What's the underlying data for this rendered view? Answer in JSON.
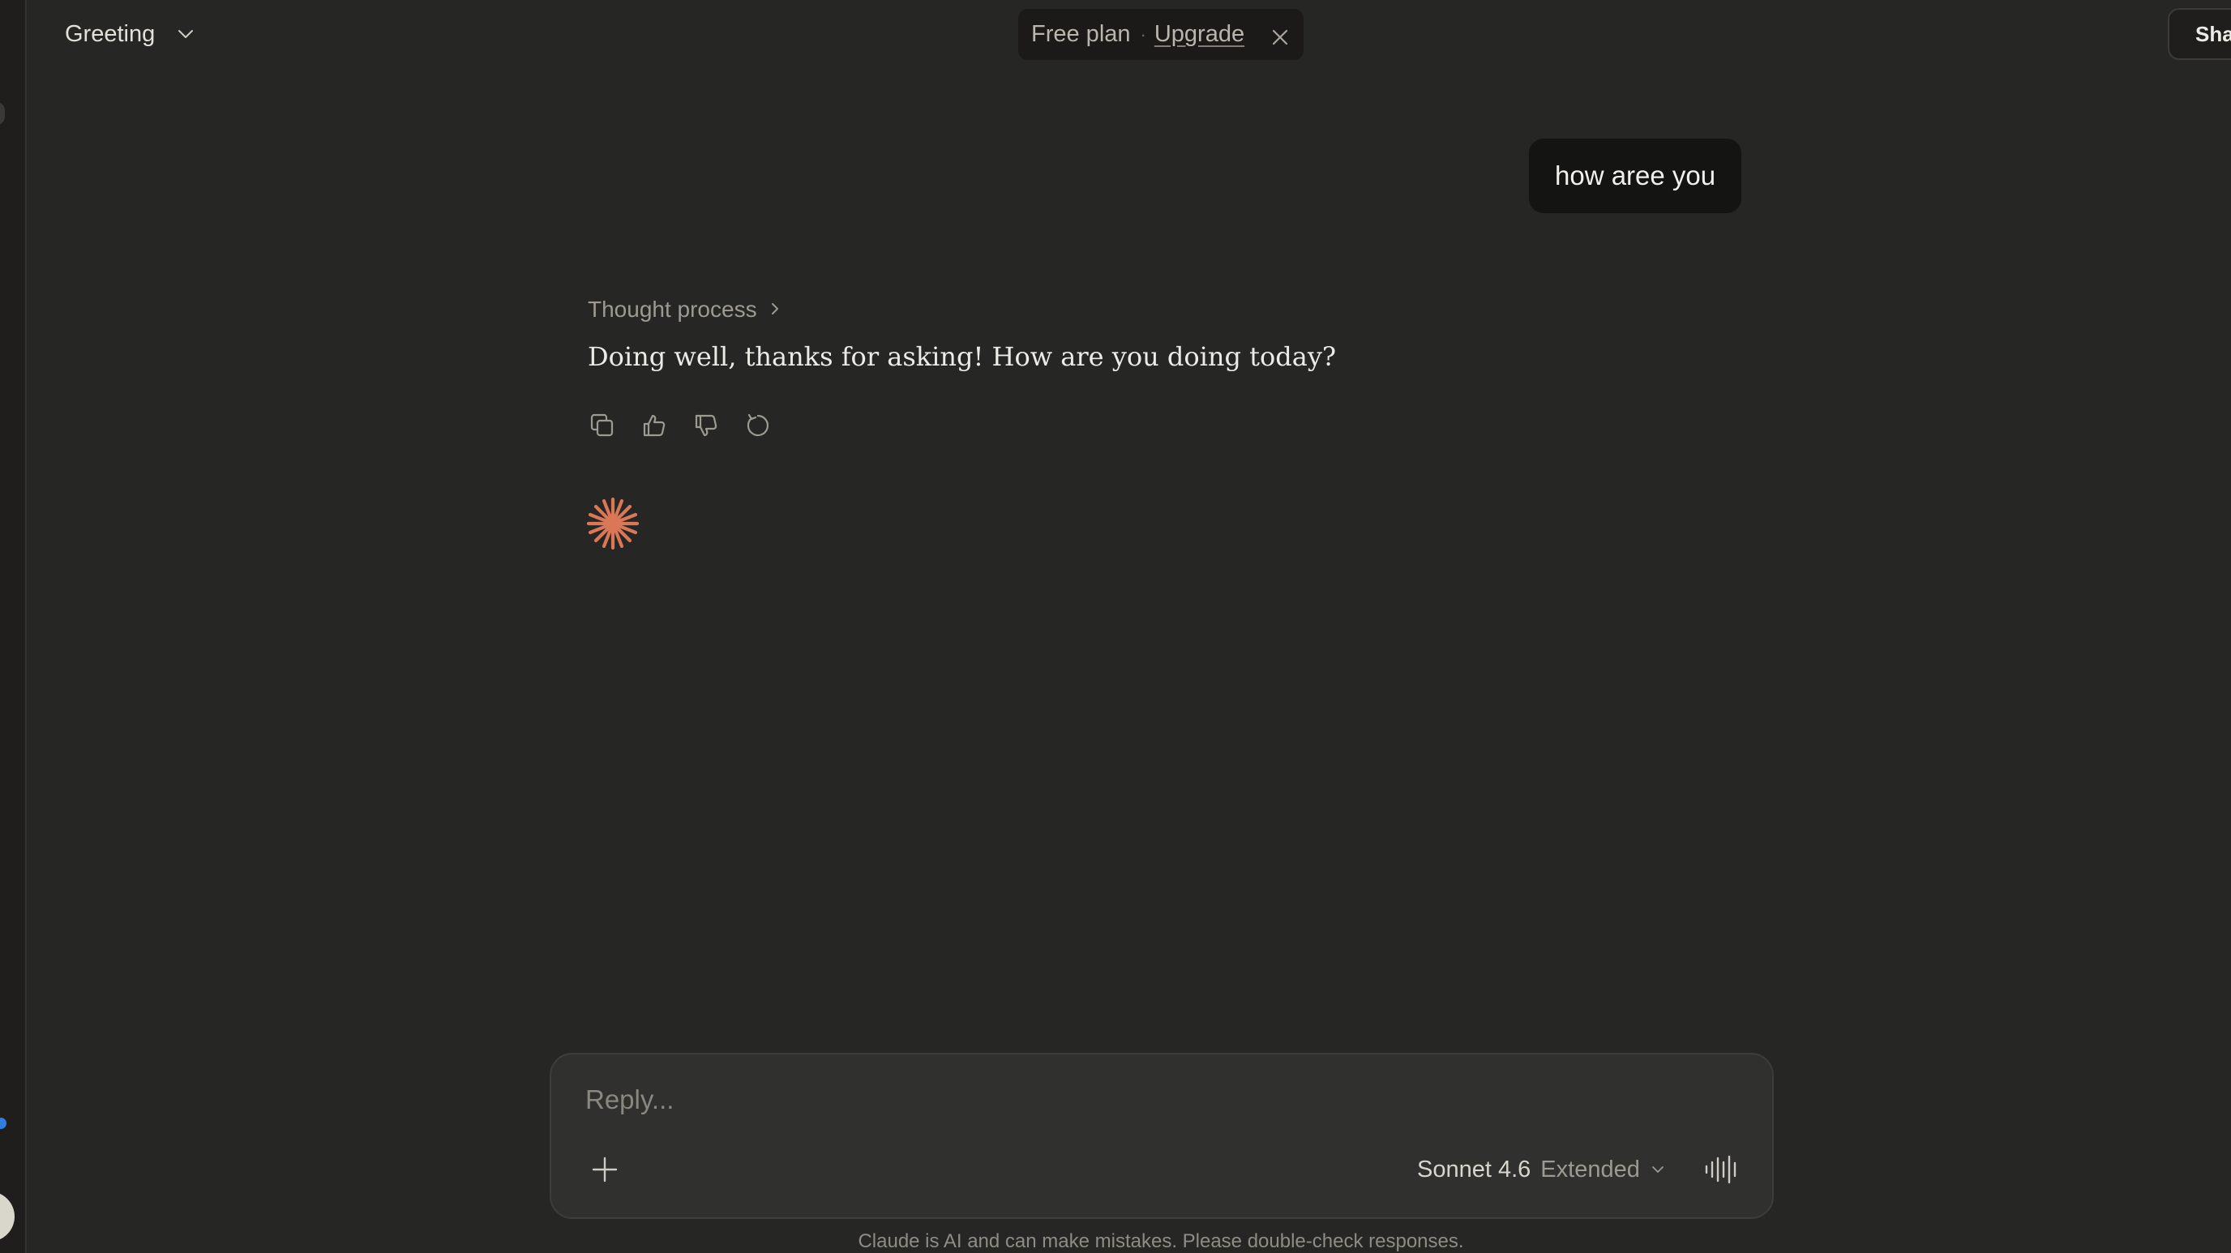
{
  "header": {
    "chat_title": "Greeting",
    "plan_label": "Free plan",
    "plan_separator": "·",
    "upgrade_label": "Upgrade",
    "share_label": "Share"
  },
  "conversation": {
    "user_message": "how aree you",
    "thought_process_label": "Thought process",
    "assistant_message": "Doing well, thanks for asking! How are you doing today?"
  },
  "composer": {
    "placeholder": "Reply...",
    "value": "",
    "model_name": "Sonnet 4.6",
    "model_mode": "Extended"
  },
  "footer": {
    "disclaimer": "Claude is AI and can make mistakes. Please double-check responses."
  },
  "colors": {
    "background": "#262624",
    "composer": "#30302e",
    "user_bubble": "#141413",
    "accent_spark": "#d97757"
  },
  "icons": {
    "title_dropdown": "chevron-down-icon",
    "plan_close": "close-icon",
    "thought_expand": "chevron-right-icon",
    "actions": [
      "copy-icon",
      "thumbs-up-icon",
      "thumbs-down-icon",
      "retry-icon"
    ],
    "spark": "claude-spark-icon",
    "add": "plus-icon",
    "model_dropdown": "chevron-down-icon",
    "voice": "voice-waveform-icon"
  }
}
